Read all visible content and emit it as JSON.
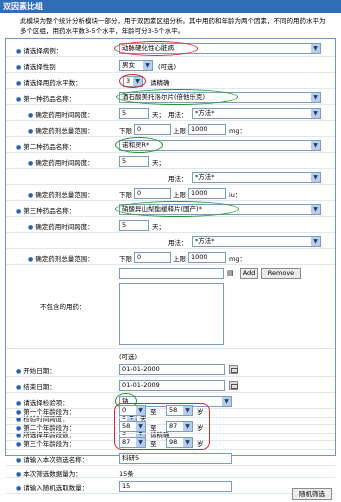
{
  "title": "双因素比组",
  "intro": "此模块为整个统计分析模块一部分，用于双因素区组分析。其中用药和年龄为两个因素，不同的用药水平为多个区组，用药水平数3-5个水平，年龄可分3-5个水平。",
  "fields": {
    "disease": {
      "label": "请选择病例：",
      "value": "动脉硬化性心脏病"
    },
    "gender": {
      "label": "请选择性别",
      "value": "男女",
      "note": "(可选)"
    },
    "level_count": {
      "label": "请选择用药水平数：",
      "value": "3",
      "note": "请精确"
    },
    "drug1": {
      "label": "第一种药品名称：",
      "value": "酒石酸美托洛尔片(倍他乐克)"
    },
    "drug1_time": {
      "label": "确定药用时间跨度：",
      "value": "5",
      "unit": "天；",
      "usage_label": "用法：",
      "usage_value": "*方法*"
    },
    "drug1_dose": {
      "label": "确定药剂总量范围：",
      "lower_label": "下限",
      "lower": "0",
      "upper_label": "上限",
      "upper": "1000",
      "unit": "mg："
    },
    "drug2": {
      "label": "第二种药品名称：",
      "value": "诺和灵R*"
    },
    "drug2_time": {
      "label": "确定药用时间跨度：",
      "value": "5",
      "unit": "天；",
      "usage_label": "用法：",
      "usage_value": "*方法*"
    },
    "drug2_dose": {
      "label": "确定药剂总量范围：",
      "lower_label": "下限",
      "lower": "0",
      "upper_label": "上限",
      "upper": "1000",
      "unit": "iu："
    },
    "drug3": {
      "label": "第三种药品名称：",
      "value": "硝酸异山梨酯缓释片(国产)*"
    },
    "drug3_time": {
      "label": "确定药用时间跨度：",
      "value": "5",
      "unit": "天；",
      "usage_label": "用法：",
      "usage_value": "*方法*"
    },
    "drug3_dose": {
      "label": "确定药剂总量范围：",
      "lower_label": "下限",
      "lower": "0",
      "upper_label": "上限",
      "upper": "1000",
      "unit": "mg："
    },
    "excluded": {
      "label": "不包含的用药：",
      "add": "Add",
      "remove": "Remove",
      "note": "(可选)"
    },
    "start_date": {
      "label": "开始日期：",
      "value": "01-01-2000"
    },
    "end_date": {
      "label": "结束日期：",
      "value": "01-01-2009"
    },
    "test_item": {
      "label": "请选择检验项：",
      "value": "钠"
    },
    "test_span": {
      "label": "检验时间跨度：",
      "value": "5",
      "unit": "天"
    },
    "group_count": {
      "label": "所选择年龄段数：",
      "value": "3",
      "note": "请精确"
    },
    "age1": {
      "label": "第一个年龄段为：",
      "from": "0",
      "sep": "至",
      "to": "58",
      "unit": "岁"
    },
    "age2": {
      "label": "第二个年龄段为：",
      "from": "58",
      "sep": "至",
      "to": "87",
      "unit": "岁"
    },
    "age3": {
      "label": "第三个年龄段为：",
      "from": "87",
      "sep": "至",
      "to": "98",
      "unit": "岁"
    },
    "filter_name": {
      "label": "请输入本次筛选名称：",
      "value": "科研5"
    },
    "filter_count": {
      "label": "本次筛选数据量为：",
      "value": "15条"
    },
    "random_count": {
      "label": "请输入随机选取数量：",
      "value": "15"
    }
  },
  "random_button": "随机筛选"
}
